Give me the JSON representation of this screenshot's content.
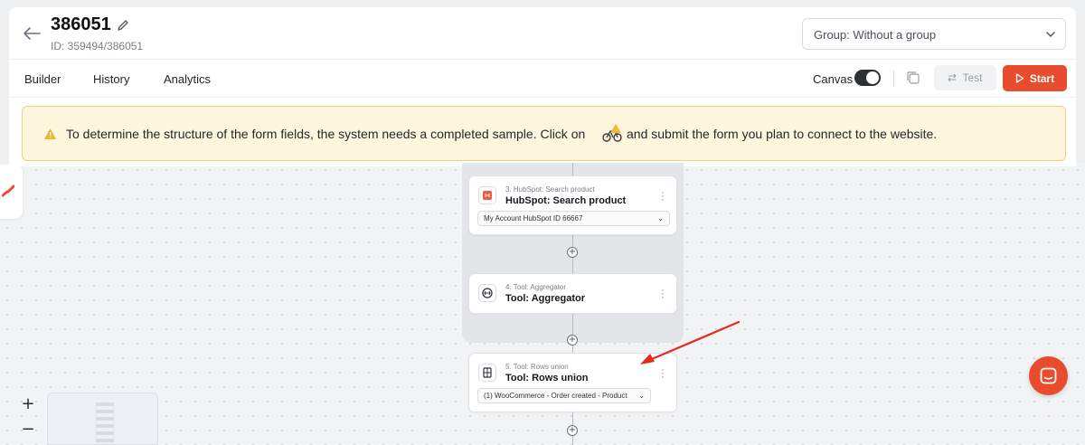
{
  "header": {
    "title": "386051",
    "id_text": "ID: 359494/386051",
    "group_select": "Group: Without a group"
  },
  "tabs": [
    {
      "label": "Builder"
    },
    {
      "label": "History"
    },
    {
      "label": "Analytics"
    }
  ],
  "toolbar": {
    "canvas_label": "Canvas",
    "canvas_toggle_on": true,
    "test_label": "Test",
    "start_label": "Start"
  },
  "alert": {
    "text_before": "To determine the structure of the form fields, the system needs a completed sample. Click on",
    "text_after": "and submit the form you plan to connect to the website."
  },
  "nodes": [
    {
      "small": "3. HubSpot: Search product",
      "title": "HubSpot: Search product",
      "select": "My Account HubSpot ID 66667",
      "icon": "hubspot-icon"
    },
    {
      "small": "4. Tool: Aggregator",
      "title": "Tool: Aggregator",
      "icon": "aggregator-icon"
    },
    {
      "small": "5. Tool: Rows union",
      "title": "Tool: Rows union",
      "select": "(1) WooCommerce - Order created - Product",
      "icon": "rows-union-icon"
    }
  ],
  "zoom": {
    "in": "+",
    "out": "−"
  },
  "colors": {
    "accent": "#e94b2e",
    "alert_bg": "#fdf5dc",
    "alert_border": "#f2d27a"
  }
}
